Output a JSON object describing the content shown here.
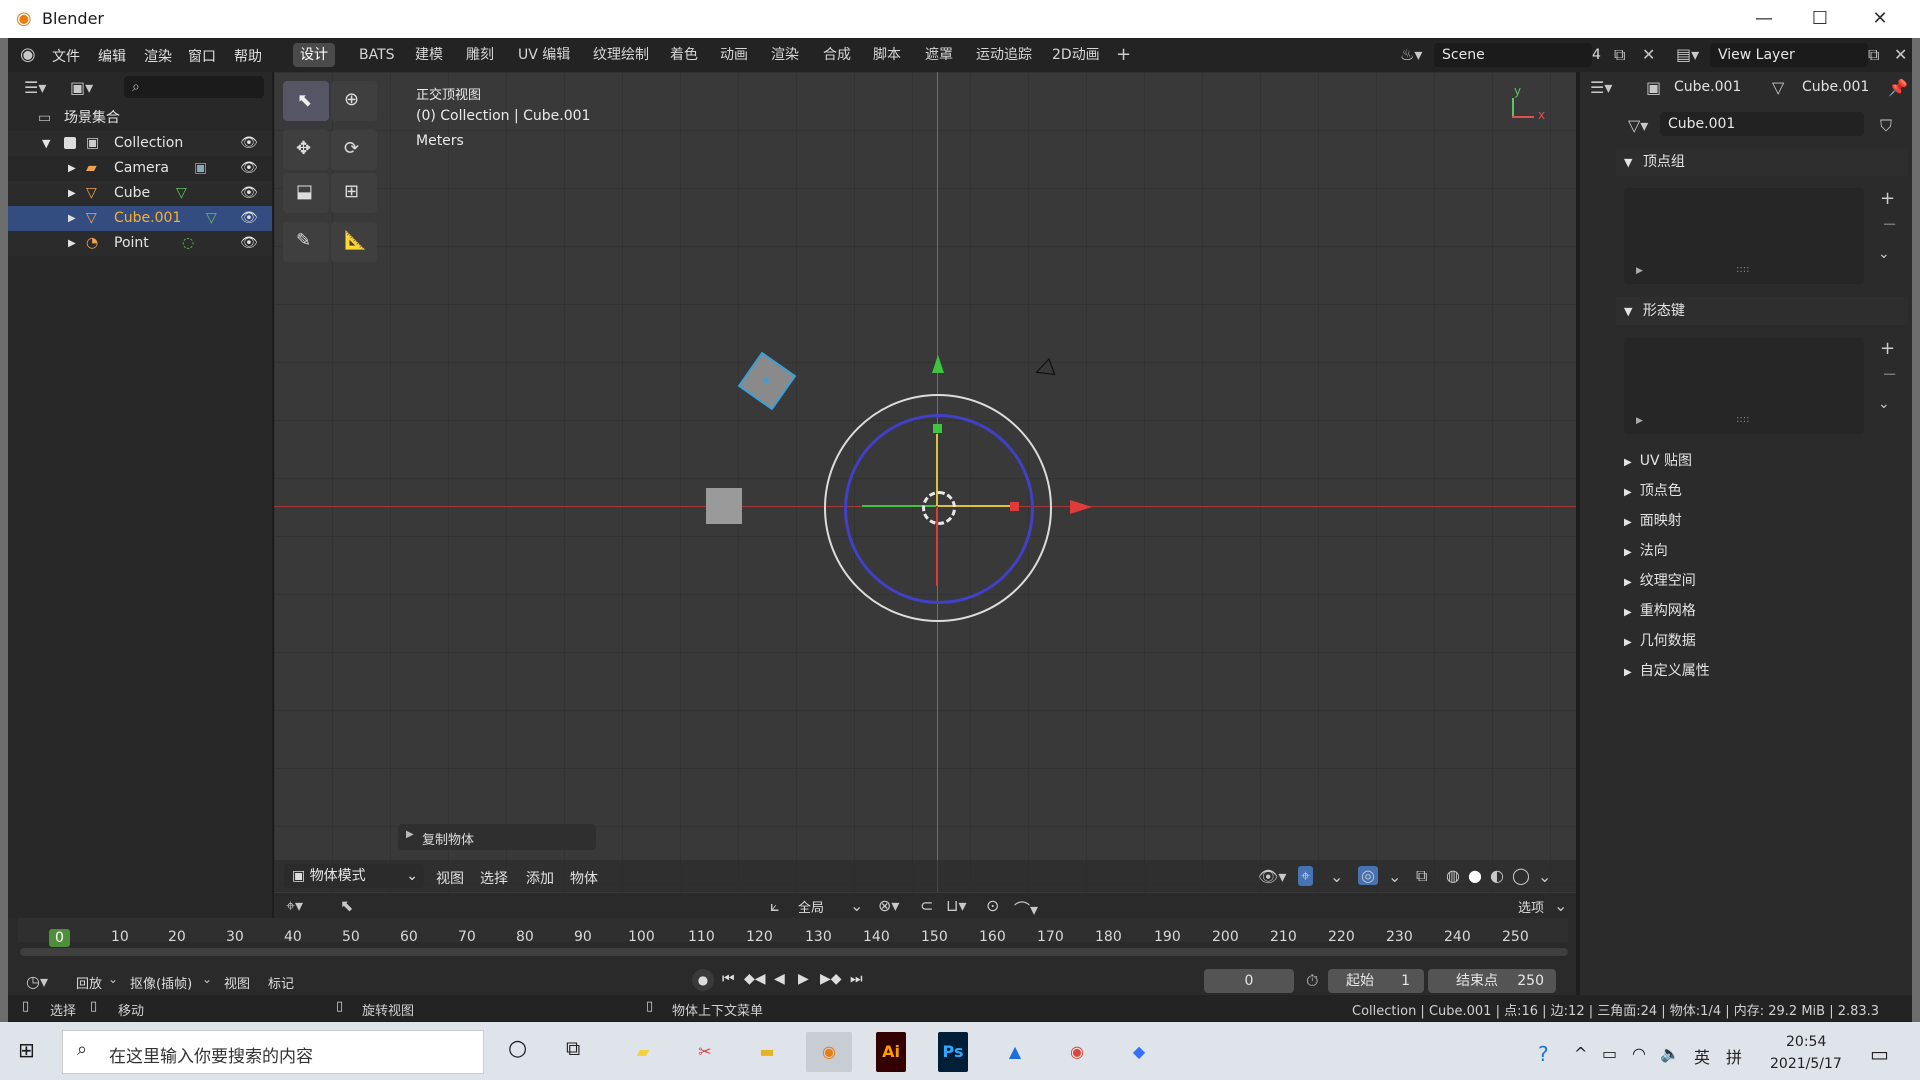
{
  "window": {
    "title": "Blender"
  },
  "menus": [
    "文件",
    "编辑",
    "渲染",
    "窗口",
    "帮助"
  ],
  "workspaces": [
    "设计",
    "BATS",
    "建模",
    "雕刻",
    "UV 编辑",
    "纹理绘制",
    "着色",
    "动画",
    "渲染",
    "合成",
    "脚本",
    "遮罩",
    "运动追踪",
    "2D动画"
  ],
  "scene": {
    "name": "Scene",
    "count": "4",
    "view_layer": "View Layer"
  },
  "outliner": {
    "root": "场景集合",
    "items": [
      {
        "label": "Collection"
      },
      {
        "label": "Camera"
      },
      {
        "label": "Cube"
      },
      {
        "label": "Cube.001"
      },
      {
        "label": "Point"
      }
    ]
  },
  "viewport": {
    "view_name": "正交顶视图",
    "context": "(0) Collection | Cube.001",
    "units": "Meters",
    "last_op": "复制物体",
    "mode": "物体模式",
    "header_menus": [
      "视图",
      "选择",
      "添加",
      "物体"
    ],
    "transform_orientation": "全局"
  },
  "properties": {
    "object_name": "Cube.001",
    "mesh_name": "Cube.001",
    "data_name": "Cube.001",
    "panels_open": [
      "顶点组",
      "形态键"
    ],
    "panels_closed": [
      "UV 贴图",
      "顶点色",
      "面映射",
      "法向",
      "纹理空间",
      "重构网格",
      "几何数据",
      "自定义属性"
    ]
  },
  "timeline": {
    "ticks": [
      "0",
      "10",
      "20",
      "30",
      "40",
      "50",
      "60",
      "70",
      "80",
      "90",
      "100",
      "110",
      "120",
      "130",
      "140",
      "150",
      "160",
      "170",
      "180",
      "190",
      "200",
      "210",
      "220",
      "230",
      "240",
      "250"
    ],
    "menus": [
      "回放",
      "抠像(插帧)",
      "视图",
      "标记"
    ],
    "current_frame": "0",
    "start_label": "起始",
    "start_value": "1",
    "end_label": "结束点",
    "end_value": "250",
    "options": "选项"
  },
  "statusbar": {
    "select": "选择",
    "move": "移动",
    "rotate": "旋转视图",
    "context_menu": "物体上下文菜单",
    "info": "Collection | Cube.001 | 点:16 | 边:12 | 三角面:24 | 物体:1/4 | 内存: 29.2 MiB | 2.83.3"
  },
  "taskbar": {
    "search_placeholder": "在这里输入你要搜索的内容",
    "ime_lang": "英",
    "ime_mode": "拼",
    "time": "20:54",
    "date": "2021/5/17"
  },
  "colors": {
    "accent": "#ffaf29",
    "selection": "#334d80",
    "x_axis": "#c43b3b",
    "y_axis": "#4fb83a"
  }
}
